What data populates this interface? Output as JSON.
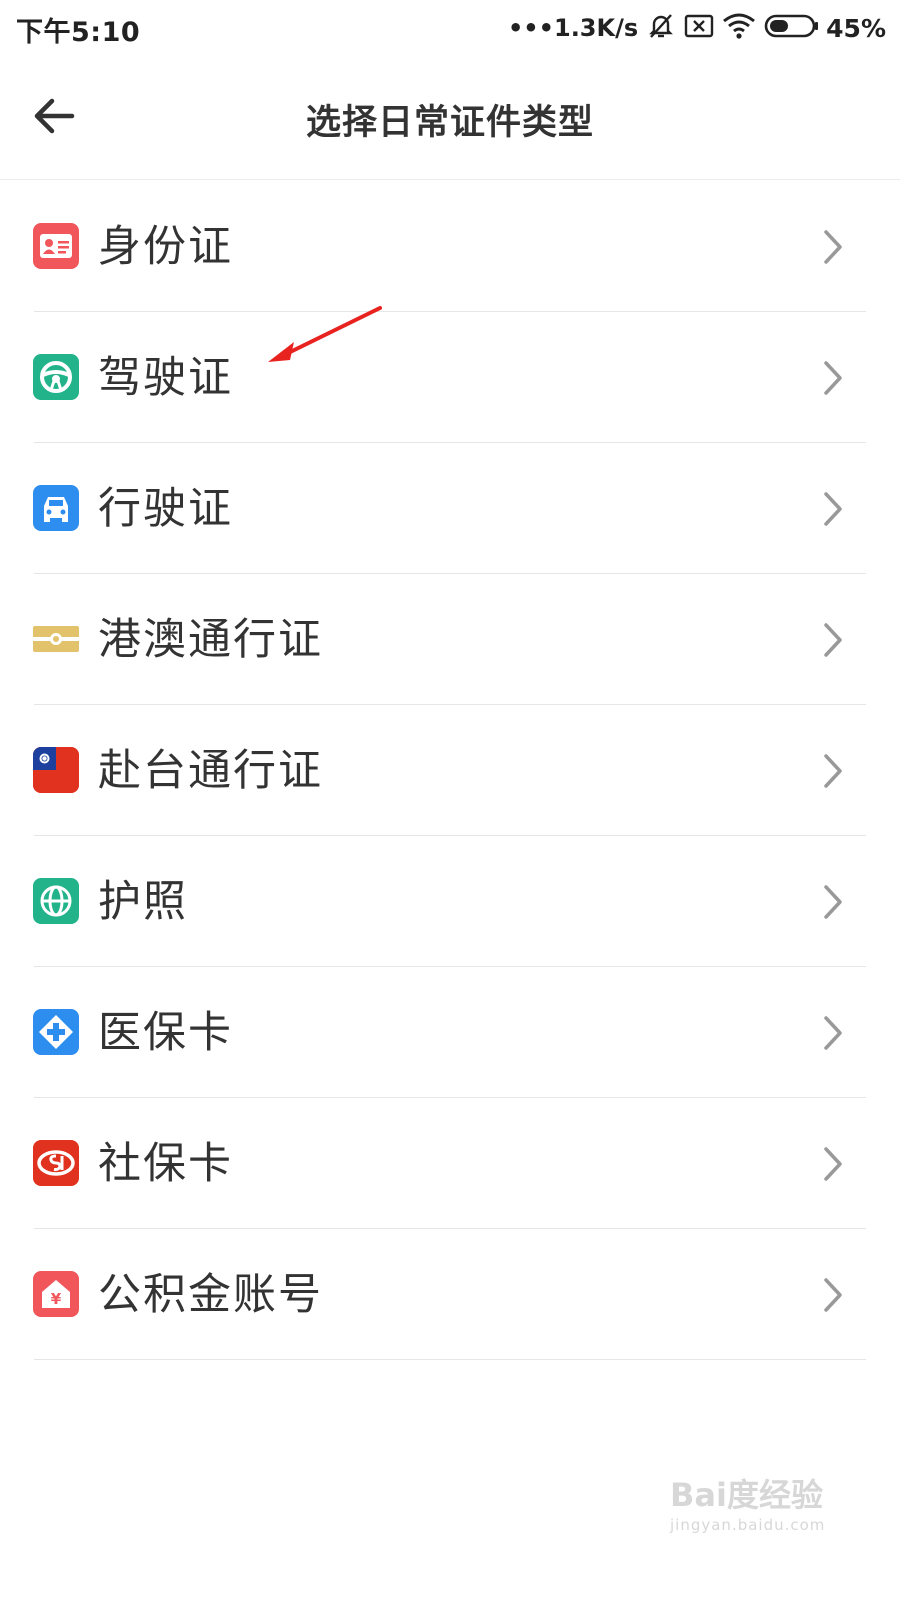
{
  "status_bar": {
    "time": "下午5:10",
    "network_speed": "•••1.3K/s",
    "battery_percent": "45%",
    "battery_level": 0.45,
    "icons": [
      "silent-icon",
      "sim-off-icon",
      "wifi-icon",
      "battery-icon"
    ]
  },
  "header": {
    "back_icon": "back-arrow-icon",
    "title": "选择日常证件类型"
  },
  "list": {
    "items": [
      {
        "label": "身份证",
        "icon": "id-card-icon",
        "icon_color": "#f0565a"
      },
      {
        "label": "驾驶证",
        "icon": "steering-wheel-icon",
        "icon_color": "#22b38a"
      },
      {
        "label": "行驶证",
        "icon": "car-icon",
        "icon_color": "#2d8ef0"
      },
      {
        "label": "港澳通行证",
        "icon": "hk-macau-pass-icon",
        "icon_color": "#e2c26a"
      },
      {
        "label": "赴台通行证",
        "icon": "taiwan-flag-icon",
        "icon_color": "#e0321e"
      },
      {
        "label": "护照",
        "icon": "globe-icon",
        "icon_color": "#22b38a"
      },
      {
        "label": "医保卡",
        "icon": "medical-cross-icon",
        "icon_color": "#2d8ef0"
      },
      {
        "label": "社保卡",
        "icon": "social-security-icon",
        "icon_color": "#e0321e"
      },
      {
        "label": "公积金账号",
        "icon": "housing-fund-icon",
        "icon_color": "#f0565a"
      }
    ],
    "chevron_icon": "chevron-right-icon"
  },
  "watermark": {
    "logo": "Bai度经验",
    "url": "jingyan.baidu.com"
  }
}
